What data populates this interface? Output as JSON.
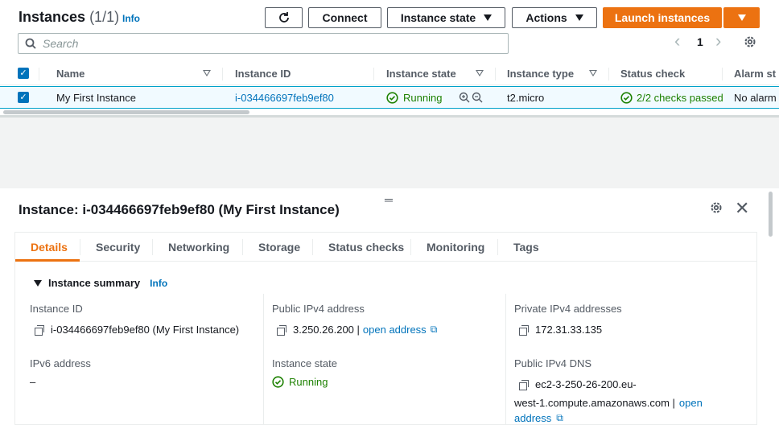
{
  "header": {
    "title": "Instances",
    "count": "(1/1)",
    "info": "Info",
    "connect": "Connect",
    "instance_state": "Instance state",
    "actions": "Actions",
    "launch": "Launch instances"
  },
  "search": {
    "placeholder": "Search"
  },
  "pagination": {
    "page": "1",
    "prev": "‹",
    "next": "›"
  },
  "table": {
    "columns": [
      "Name",
      "Instance ID",
      "Instance state",
      "Instance type",
      "Status check",
      "Alarm st"
    ],
    "row": {
      "name": "My First Instance",
      "id": "i-034466697feb9ef80",
      "state": "Running",
      "type": "t2.micro",
      "status": "2/2 checks passed",
      "alarm": "No alarm"
    }
  },
  "panel": {
    "title": "Instance: i-034466697feb9ef80 (My First Instance)",
    "tabs": [
      "Details",
      "Security",
      "Networking",
      "Storage",
      "Status checks",
      "Monitoring",
      "Tags"
    ],
    "summary": "Instance summary",
    "info": "Info",
    "fields": {
      "instance_id_label": "Instance ID",
      "instance_id_value": "i-034466697feb9ef80 (My First Instance)",
      "public_ipv4_label": "Public IPv4 address",
      "public_ipv4_value": "3.250.26.200 |",
      "open_address": "open address",
      "private_ipv4_label": "Private IPv4 addresses",
      "private_ipv4_value": "172.31.33.135",
      "ipv6_label": "IPv6 address",
      "ipv6_value": "–",
      "state_label": "Instance state",
      "state_value": "Running",
      "dns_label": "Public IPv4 DNS",
      "dns_line1": "ec2-3-250-26-200.eu-",
      "dns_line2": "west-1.compute.amazonaws.com |",
      "dns_open": "open",
      "dns_address": "address"
    }
  },
  "colors": {
    "accent": "#ec7211",
    "link": "#0073bb",
    "success": "#1d8102"
  }
}
